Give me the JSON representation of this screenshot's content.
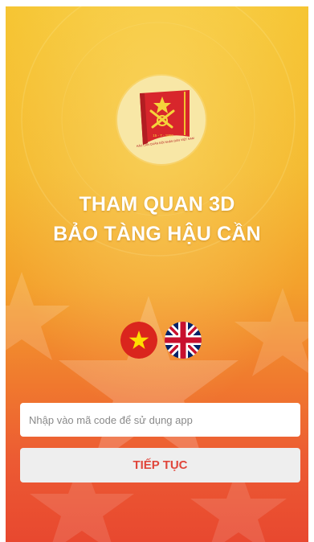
{
  "logo": {
    "icon": "museum-emblem-icon",
    "inscription": "HẬU CẦN QUÂN ĐỘI NHÂN DÂN VIỆT NAM",
    "date": "15 - 7 - 1950"
  },
  "title": {
    "line1": "THAM QUAN 3D",
    "line2": "BẢO TÀNG HẬU CẦN"
  },
  "languages": [
    {
      "code": "vi",
      "icon": "vietnam-flag-icon",
      "color": "#da251d"
    },
    {
      "code": "en",
      "icon": "uk-flag-icon",
      "color": "#012169"
    }
  ],
  "code_field": {
    "value": "",
    "placeholder": "Nhập vào mã code để sử dụng app"
  },
  "continue_button": {
    "label": "TIẾP TỤC"
  },
  "colors": {
    "background_top": "#f6c532",
    "background_bottom": "#e8482f",
    "button_text": "#e0463b"
  }
}
